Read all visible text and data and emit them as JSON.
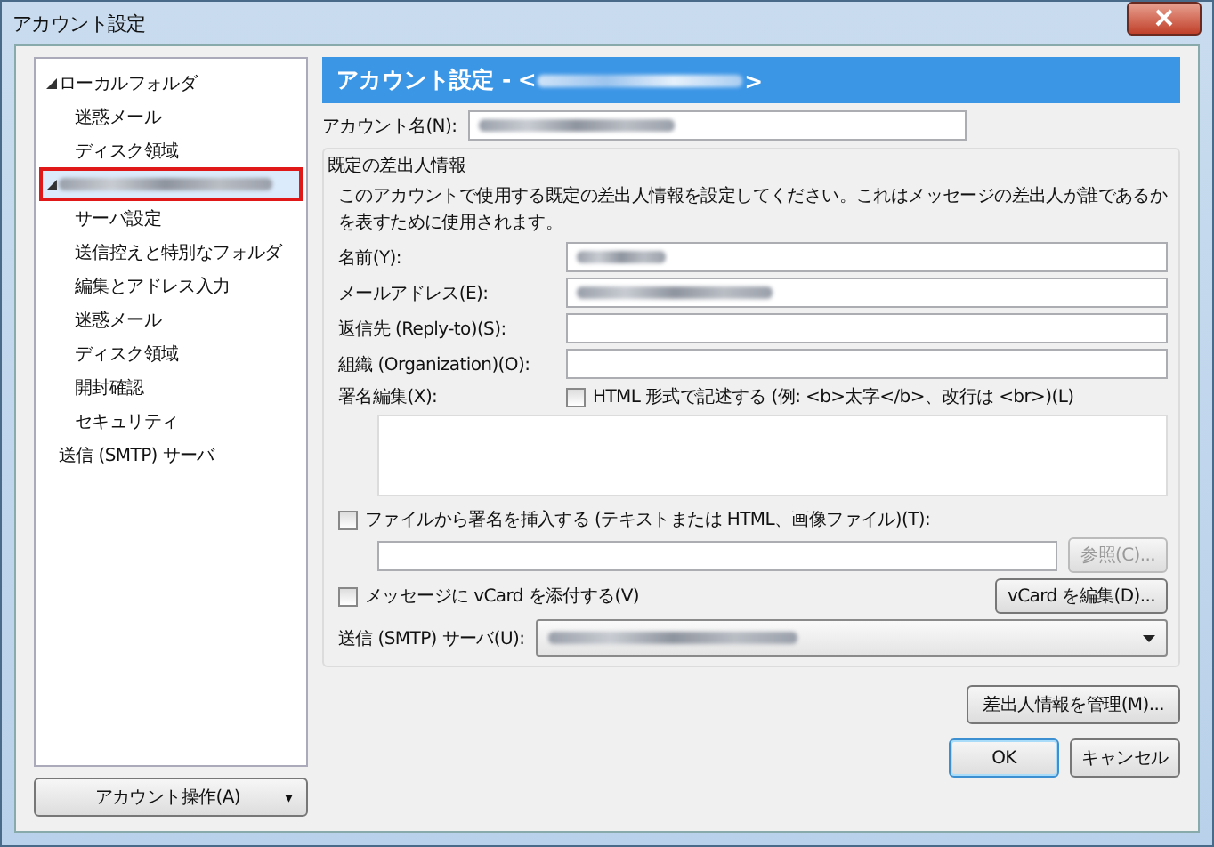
{
  "window": {
    "title": "アカウント設定"
  },
  "tree": [
    {
      "label": "ローカルフォルダ",
      "kind": "text",
      "expanded": true,
      "selected": false,
      "children": [
        {
          "label": "迷惑メール",
          "selected": false
        },
        {
          "label": "ディスク領域",
          "selected": false
        }
      ]
    },
    {
      "kind": "redacted",
      "expanded": true,
      "selected": true,
      "children": [
        {
          "label": "サーバ設定",
          "selected": false
        },
        {
          "label": "送信控えと特別なフォルダ",
          "selected": false
        },
        {
          "label": "編集とアドレス入力",
          "selected": false
        },
        {
          "label": "迷惑メール",
          "selected": false
        },
        {
          "label": "ディスク領域",
          "selected": false
        },
        {
          "label": "開封確認",
          "selected": false
        },
        {
          "label": "セキュリティ",
          "selected": false
        }
      ]
    },
    {
      "label": "送信 (SMTP) サーバ",
      "kind": "text",
      "expanded": false,
      "selected": false
    }
  ],
  "account_actions_button": {
    "label": "アカウント操作(A)",
    "caret": "▾"
  },
  "header": {
    "prefix": "アカウント設定 - <",
    "suffix": ">"
  },
  "account_name": {
    "label": "アカウント名(N):",
    "value_redacted": true
  },
  "identity": {
    "legend": "既定の差出人情報",
    "description": "このアカウントで使用する既定の差出人情報を設定してください。これはメッセージの差出人が誰であるかを表すために使用されます。",
    "fields": [
      {
        "label": "名前(Y):",
        "value_redacted": true
      },
      {
        "label": "メールアドレス(E):",
        "value_redacted": true
      },
      {
        "label": "返信先 (Reply-to)(S):",
        "value_redacted": false
      },
      {
        "label": "組織 (Organization)(O):",
        "value_redacted": false
      }
    ],
    "signature_label": "署名編集(X):",
    "html_checkbox": {
      "label": "HTML 形式で記述する (例: <b>太字</b>、改行は <br>)(L)",
      "checked": false
    },
    "file_checkbox": {
      "label": "ファイルから署名を挿入する (テキストまたは HTML、画像ファイル)(T):",
      "checked": false
    },
    "browse_button": {
      "label": "参照(C)...",
      "disabled": true
    },
    "vcard_checkbox": {
      "label": "メッセージに vCard を添付する(V)",
      "checked": false
    },
    "vcard_button": {
      "label": "vCard を編集(D)..."
    },
    "smtp": {
      "label": "送信 (SMTP) サーバ(U):",
      "value_redacted": true
    }
  },
  "manage_button": {
    "label": "差出人情報を管理(M)..."
  },
  "buttons": [
    {
      "label": "OK",
      "default": true
    },
    {
      "label": "キャンセル",
      "default": false
    }
  ]
}
